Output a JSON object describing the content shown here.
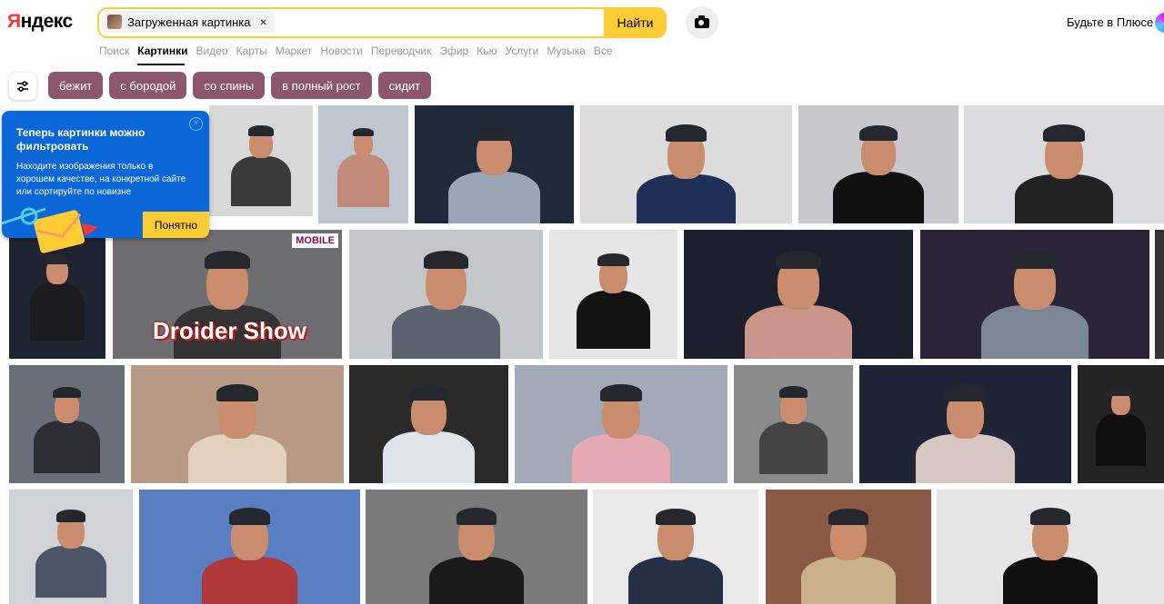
{
  "header": {
    "logo": "Яндекс",
    "search_chip_label": "Загруженная картинка",
    "search_chip_close": "×",
    "find_label": "Найти",
    "plus_label": "Будьте в Плюсе"
  },
  "nav": {
    "items": [
      "Поиск",
      "Картинки",
      "Видео",
      "Карты",
      "Маркет",
      "Новости",
      "Переводчик",
      "Эфир",
      "Кью",
      "Услуги",
      "Музыка",
      "Все"
    ],
    "active_index": 1
  },
  "tags": [
    "бежит",
    "с бородой",
    "со спины",
    "в полный рост",
    "сидит"
  ],
  "popup": {
    "title": "Теперь картинки можно фильтровать",
    "body": "Находите изображения только в хорошем качестве, на конкретной сайте или сортируйте по новизне",
    "ok_label": "Понятно"
  },
  "results": {
    "overlay_text": "Droider Show",
    "overlay_badge": "MOBILE"
  },
  "colors": {
    "accent": "#ffcc33",
    "tag_bg": "#8c566b",
    "popup_bg": "#0a67d8",
    "logo_red": "#ff3333"
  }
}
